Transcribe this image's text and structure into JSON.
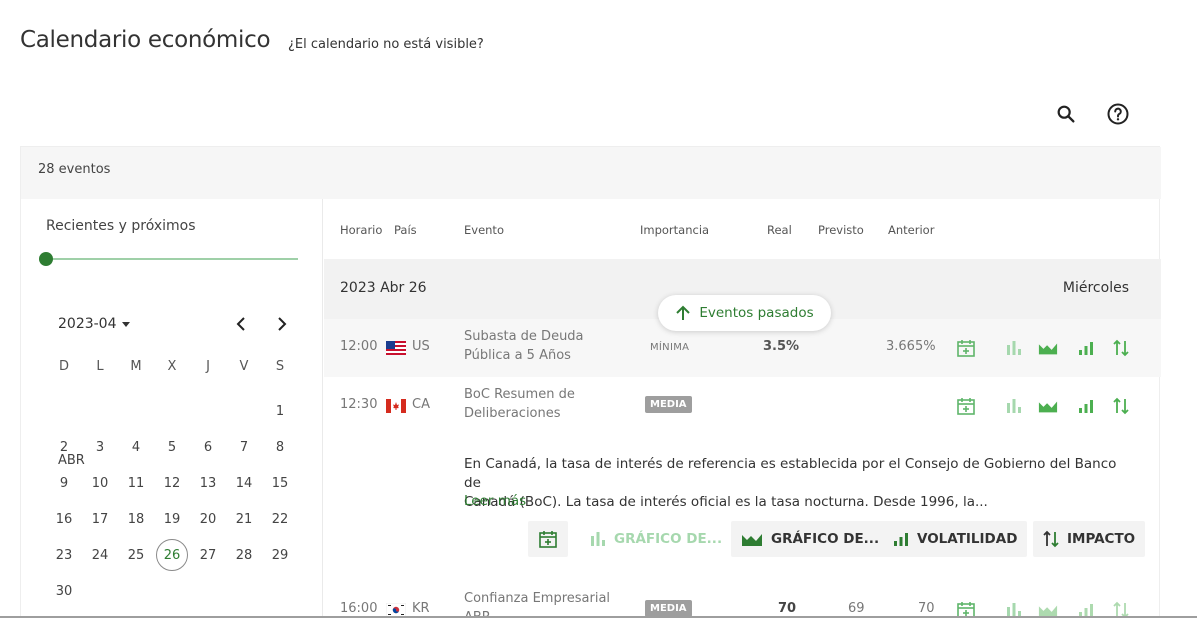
{
  "header": {
    "title": "Calendario económico",
    "calendar_not_visible": "¿El calendario no está visible?"
  },
  "toolbar": {
    "search_icon": "search-icon",
    "help_icon": "help-icon"
  },
  "events_count": "28 eventos",
  "filters": {
    "range_label": "Recientes y próximos",
    "month": "2023-04",
    "weekdays": [
      "D",
      "L",
      "M",
      "X",
      "J",
      "V",
      "S"
    ],
    "month_abbrev": "ABR",
    "selected_day": "26"
  },
  "table": {
    "columns": {
      "time": "Horario",
      "country": "País",
      "event": "Evento",
      "importance": "Importancia",
      "actual": "Real",
      "forecast": "Previsto",
      "previous": "Anterior"
    },
    "day": {
      "date": "2023 Abr 26",
      "weekday": "Miércoles"
    },
    "past_events_button": "Eventos pasados",
    "rows": [
      {
        "time": "12:00",
        "country": "US",
        "event_line1": "Subasta de Deuda",
        "event_line2": "Pública a 5 Años",
        "importance": "MÍNIMA",
        "actual": "3.5%",
        "forecast": "",
        "previous": "3.665%"
      },
      {
        "time": "12:30",
        "country": "CA",
        "event_line1": "BoC Resumen de",
        "event_line2": "Deliberaciones",
        "importance": "MEDIA",
        "actual": "",
        "forecast": "",
        "previous": ""
      },
      {
        "time": "16:00",
        "country": "KR",
        "event_line1": "Confianza Empresarial",
        "event_line2": "ABR",
        "importance": "MEDIA",
        "actual": "70",
        "forecast": "69",
        "previous": "70"
      }
    ],
    "expanded": {
      "description_line1": "En Canadá, la tasa de interés de referencia es establecida por el Consejo de Gobierno del Banco de",
      "description_line2": "Canadá (BoC). La tasa de interés oficial es la tasa nocturna. Desde 1996, la...",
      "read_more": "Leer más",
      "buttons": {
        "chart1": "GRÁFICO DE...",
        "chart2": "GRÁFICO DE...",
        "volatility": "VOLATILIDAD",
        "impact": "IMPACTO"
      }
    }
  },
  "colors": {
    "accent": "#2e7d32",
    "accent_light": "#a6d8ae",
    "badge": "#9e9e9e"
  }
}
